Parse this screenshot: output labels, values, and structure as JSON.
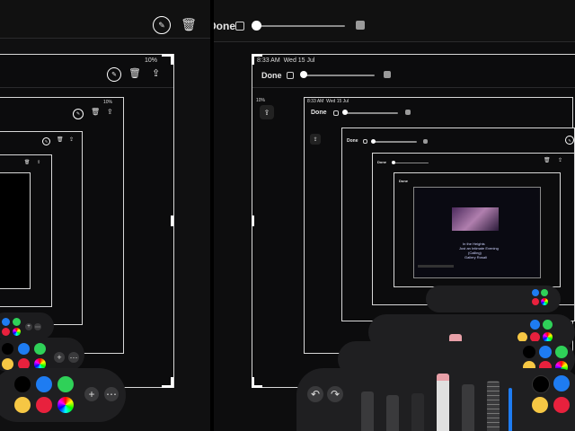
{
  "status": {
    "time": "8:33 AM",
    "date": "Wed 15 Jul",
    "battery": "10%"
  },
  "toolbar": {
    "done_label": "Done"
  },
  "icons": {
    "markup": "markup-pen-icon",
    "trash": "trash-icon",
    "share": "share-icon",
    "add": "plus-icon",
    "more": "more-icon"
  },
  "colors": {
    "black": "#000000",
    "blue": "#1e7cf2",
    "green": "#2fd158",
    "yellow": "#f6c744",
    "red": "#e8213d",
    "multicolor": "conic"
  },
  "inner_page": {
    "headline_lines": [
      "In the Heights",
      "Just an Intimate Evening",
      "(Calling)",
      "Gallery Rosali"
    ]
  }
}
